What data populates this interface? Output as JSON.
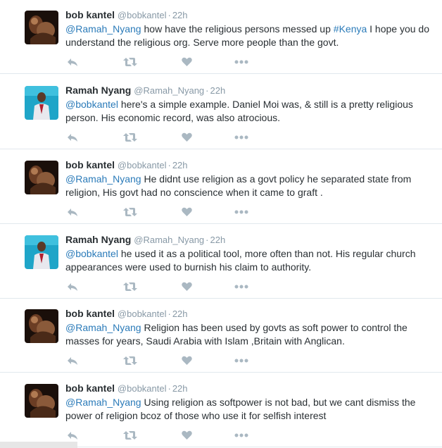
{
  "tweets": [
    {
      "fullname": "bob kantel",
      "username": "@bobkantel",
      "time": "22h",
      "avatar": "bob-avatar",
      "text_parts": [
        {
          "kind": "mention",
          "text": "@Ramah_Nyang"
        },
        {
          "kind": "plain",
          "text": " how have the religious persons messed up "
        },
        {
          "kind": "hashtag",
          "text": "#Kenya"
        },
        {
          "kind": "plain",
          "text": " I hope you do understand the religious org. Serve more people than the govt."
        }
      ]
    },
    {
      "fullname": "Ramah Nyang",
      "username": "@Ramah_Nyang",
      "time": "22h",
      "avatar": "ramah-avatar",
      "text_parts": [
        {
          "kind": "mention",
          "text": "@bobkantel"
        },
        {
          "kind": "plain",
          "text": " here's a simple example. Daniel Moi was, & still is a pretty religious person. His economic record, was also atrocious."
        }
      ]
    },
    {
      "fullname": "bob kantel",
      "username": "@bobkantel",
      "time": "22h",
      "avatar": "bob-avatar",
      "text_parts": [
        {
          "kind": "mention",
          "text": "@Ramah_Nyang"
        },
        {
          "kind": "plain",
          "text": " He didnt use religion as a govt policy he separated state from religion, His govt had no conscience when it came to graft ."
        }
      ]
    },
    {
      "fullname": "Ramah Nyang",
      "username": "@Ramah_Nyang",
      "time": "22h",
      "avatar": "ramah-avatar",
      "text_parts": [
        {
          "kind": "mention",
          "text": "@bobkantel"
        },
        {
          "kind": "plain",
          "text": " he used it as a political tool, more often than not. His regular church appearances were used to burnish his claim to authority."
        }
      ]
    },
    {
      "fullname": "bob kantel",
      "username": "@bobkantel",
      "time": "22h",
      "avatar": "bob-avatar",
      "text_parts": [
        {
          "kind": "mention",
          "text": "@Ramah_Nyang"
        },
        {
          "kind": "plain",
          "text": " Religion has been used by govts as soft power to control the masses for years, Saudi Arabia with Islam ,Britain with Anglican."
        }
      ]
    },
    {
      "fullname": "bob kantel",
      "username": "@bobkantel",
      "time": "22h",
      "avatar": "bob-avatar",
      "text_parts": [
        {
          "kind": "mention",
          "text": "@Ramah_Nyang"
        },
        {
          "kind": "plain",
          "text": " Using religion as softpower is not bad, but we cant dismiss the power of religion bcoz of those who use it for selfish interest"
        }
      ]
    }
  ],
  "actions": [
    {
      "name": "reply-icon"
    },
    {
      "name": "retweet-icon"
    },
    {
      "name": "like-icon"
    },
    {
      "name": "more-icon"
    }
  ],
  "separator": "·",
  "colors": {
    "link": "#2b7bb9",
    "meta": "#8899a6",
    "icon": "#aab8c2",
    "divider": "#e1e8ed"
  }
}
